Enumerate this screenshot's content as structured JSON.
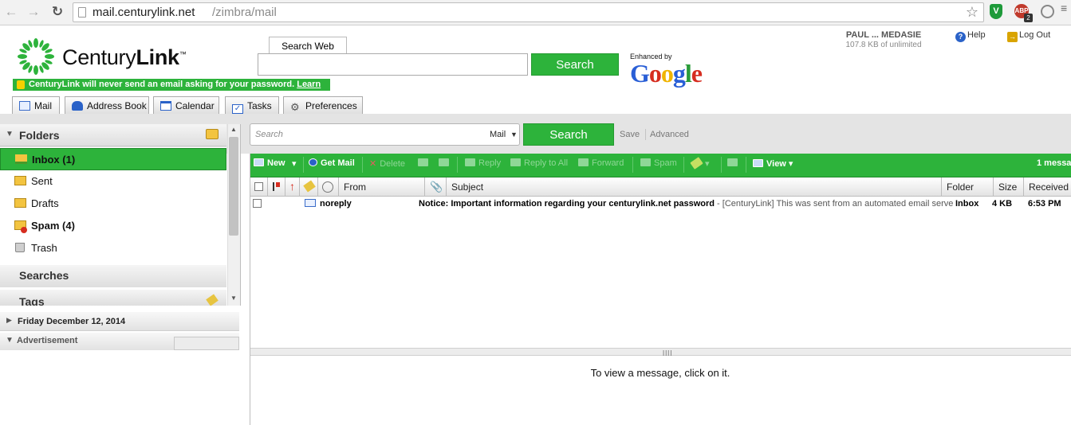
{
  "browser": {
    "url_host": "mail.centurylink.net",
    "url_path": "/zimbra/mail",
    "ext_abp_label": "ABP",
    "ext_abp_count": "2"
  },
  "header": {
    "logo_text_regular": "Century",
    "logo_text_bold": "Link",
    "logo_tm": "™",
    "security_notice": "CenturyLink will never send an email asking for your password.",
    "security_link": "Learn More",
    "search_web_tab": "Search Web",
    "search_web_button": "Search",
    "enhanced_by": "Enhanced by",
    "google": "Google",
    "user_name": "PAUL ... MEDASIE",
    "quota": "107.8 KB of unlimited",
    "help": "Help",
    "logout": "Log Out"
  },
  "tabs": [
    {
      "label": "Mail"
    },
    {
      "label": "Address Book"
    },
    {
      "label": "Calendar"
    },
    {
      "label": "Tasks"
    },
    {
      "label": "Preferences"
    }
  ],
  "sidebar": {
    "folders_title": "Folders",
    "folders": [
      {
        "label": "Inbox (1)"
      },
      {
        "label": "Sent"
      },
      {
        "label": "Drafts"
      },
      {
        "label": "Spam (4)"
      },
      {
        "label": "Trash"
      }
    ],
    "searches_title": "Searches",
    "tags_title": "Tags",
    "date": "Friday December 12, 2014",
    "advertisement": "Advertisement"
  },
  "search": {
    "placeholder": "Search",
    "scope": "Mail",
    "button": "Search",
    "save": "Save",
    "advanced": "Advanced"
  },
  "toolbar": {
    "new": "New",
    "get_mail": "Get Mail",
    "delete": "Delete",
    "reply": "Reply",
    "reply_all": "Reply to All",
    "forward": "Forward",
    "spam": "Spam",
    "view": "View",
    "count": "1 messa"
  },
  "list": {
    "columns": {
      "from": "From",
      "subject": "Subject",
      "folder": "Folder",
      "size": "Size",
      "received": "Received"
    },
    "messages": [
      {
        "from": "noreply",
        "subject": "Notice: Important information regarding your centurylink.net password",
        "fragment": " - [CenturyLink] This was sent from an automated email serve",
        "folder": "Inbox",
        "size": "4 KB",
        "received": "6:53 PM"
      }
    ]
  },
  "reading_pane": {
    "hint": "To view a message, click on it."
  },
  "colors": {
    "accent_green": "#2db33b"
  }
}
